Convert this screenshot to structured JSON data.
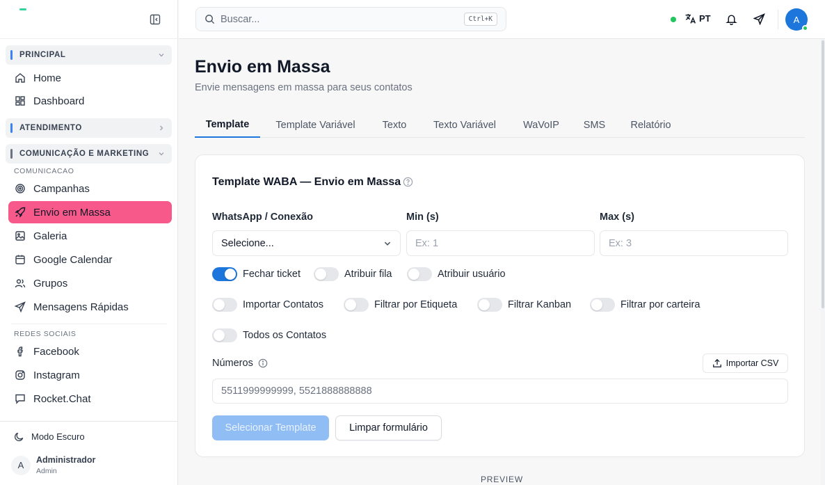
{
  "sidebar": {
    "sections": [
      {
        "label": "PRINCIPAL",
        "bar_color": "#3b82f6"
      },
      {
        "label": "ATENDIMENTO",
        "bar_color": "#3b82f6"
      },
      {
        "label": "COMUNICAÇÃO E MARKETING",
        "bar_color": "#6b7280"
      }
    ],
    "principal_items": [
      {
        "label": "Home",
        "icon": "home-icon"
      },
      {
        "label": "Dashboard",
        "icon": "dashboard-icon"
      }
    ],
    "comunicacao_label": "COMUNICACAO",
    "comunicacao_items": [
      {
        "label": "Campanhas",
        "icon": "target-icon"
      },
      {
        "label": "Envio em Massa",
        "icon": "rocket-icon",
        "active": true
      },
      {
        "label": "Galeria",
        "icon": "image-icon"
      },
      {
        "label": "Google Calendar",
        "icon": "calendar-icon"
      },
      {
        "label": "Grupos",
        "icon": "users-icon"
      },
      {
        "label": "Mensagens Rápidas",
        "icon": "send-icon"
      }
    ],
    "redes_label": "REDES SOCIAIS",
    "redes_items": [
      {
        "label": "Facebook",
        "icon": "facebook-icon"
      },
      {
        "label": "Instagram",
        "icon": "instagram-icon"
      },
      {
        "label": "Rocket.Chat",
        "icon": "chat-icon"
      }
    ],
    "dark_mode_label": "Modo Escuro",
    "user": {
      "initial": "A",
      "name": "Administrador",
      "role": "Admin"
    }
  },
  "topbar": {
    "search_placeholder": "Buscar...",
    "search_shortcut": "Ctrl+K",
    "language": "PT",
    "avatar_initial": "A"
  },
  "main": {
    "title": "Envio em Massa",
    "subtitle": "Envie mensagens em massa para seus contatos",
    "tabs": [
      "Template",
      "Template Variável",
      "Texto",
      "Texto Variável",
      "WaVoIP",
      "SMS",
      "Relatório"
    ],
    "active_tab": "Template",
    "card": {
      "title": "Template WABA — Envio em Massa",
      "whatsapp_label": "WhatsApp / Conexão",
      "whatsapp_value": "Selecione...",
      "min_label": "Min (s)",
      "min_placeholder": "Ex: 1",
      "max_label": "Max (s)",
      "max_placeholder": "Ex: 3",
      "toggles": [
        {
          "label": "Fechar ticket",
          "on": true
        },
        {
          "label": "Atribuir fila",
          "on": false
        },
        {
          "label": "Atribuir usuário",
          "on": false
        },
        {
          "label": "Importar Contatos",
          "on": false
        },
        {
          "label": "Filtrar por Etiqueta",
          "on": false
        },
        {
          "label": "Filtrar Kanban",
          "on": false
        },
        {
          "label": "Filtrar por carteira",
          "on": false
        },
        {
          "label": "Todos os Contatos",
          "on": false
        }
      ],
      "numeros_label": "Números",
      "import_csv_label": "Importar CSV",
      "numeros_placeholder": "5511999999999, 5521888888888",
      "select_template_label": "Selecionar Template",
      "clear_form_label": "Limpar formulário"
    },
    "preview_label": "PREVIEW"
  },
  "colors": {
    "accent": "#1d76db",
    "active_nav": "#f7598a",
    "online": "#22c55e"
  }
}
